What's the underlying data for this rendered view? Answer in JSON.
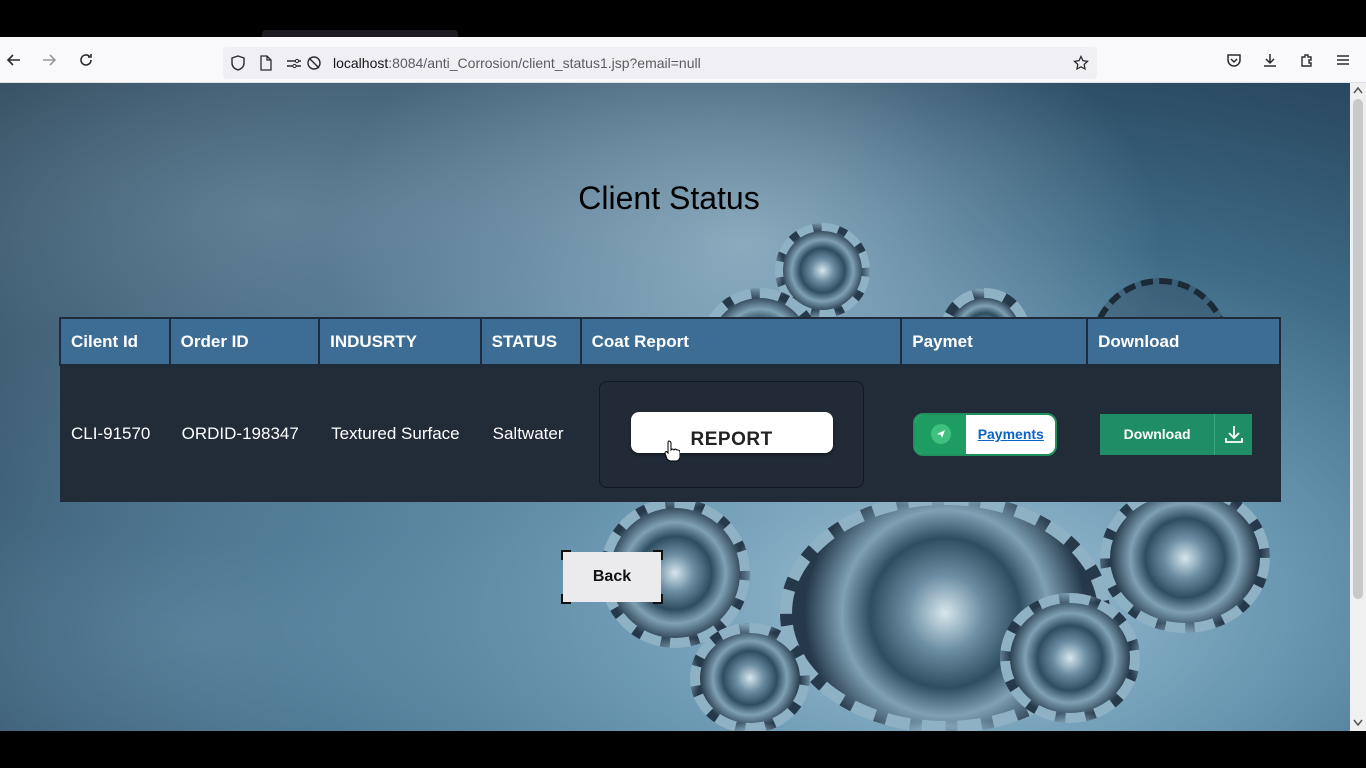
{
  "browser": {
    "url_host": "localhost",
    "url_rest": ":8084/anti_Corrosion/client_status1.jsp?email=null",
    "icons": [
      "back-arrow-icon",
      "forward-arrow-icon",
      "reload-icon",
      "shield-icon",
      "page-icon",
      "permissions-icon",
      "tracking-off-icon",
      "star-icon",
      "pocket-icon",
      "download-icon",
      "extensions-icon",
      "menu-icon"
    ]
  },
  "page": {
    "title": "Client Status",
    "table": {
      "headers": [
        "Cilent Id",
        "Order ID",
        "INDUSRTY",
        "STATUS",
        "Coat Report",
        "Paymet",
        "Download"
      ],
      "rows": [
        {
          "client_id": "CLI-91570",
          "order_id": "ORDID-198347",
          "industry": "Textured Surface",
          "status": "Saltwater",
          "report_label": "REPORT",
          "payment_label": "Payments",
          "download_label": "Download"
        }
      ]
    },
    "back_label": "Back"
  },
  "colors": {
    "header_bg": "#3d6d94",
    "row_bg": "#222b38",
    "payment_green": "#1e9d63",
    "download_green": "#1f8e66",
    "payment_link": "#0b63c9"
  }
}
